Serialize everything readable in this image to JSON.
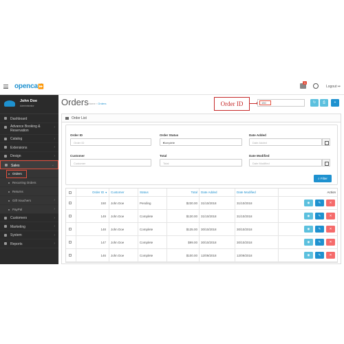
{
  "header": {
    "logo": "opencart",
    "logo_mark": "⏩",
    "alert_count": "1",
    "logout": "Logout"
  },
  "profile": {
    "name": "John Doe",
    "role": "Administrator"
  },
  "sidebar": {
    "items": [
      {
        "label": "Dashboard",
        "icon": "dashboard-icon"
      },
      {
        "label": "Advance Booking & Reservation",
        "icon": "calendar-icon"
      },
      {
        "label": "Catalog",
        "icon": "tag-icon"
      },
      {
        "label": "Extensions",
        "icon": "puzzle-icon"
      },
      {
        "label": "Design",
        "icon": "monitor-icon"
      },
      {
        "label": "Sales",
        "icon": "cart-icon"
      }
    ],
    "sales_sub": [
      "Orders",
      "Recurring Orders",
      "Returns",
      "Gift Vouchers",
      "PayPal"
    ],
    "after_items": [
      {
        "label": "Customers",
        "icon": "user-icon"
      },
      {
        "label": "Marketing",
        "icon": "share-icon"
      },
      {
        "label": "System",
        "icon": "cog-icon"
      },
      {
        "label": "Reports",
        "icon": "bar-chart-icon"
      }
    ]
  },
  "page": {
    "title": "Orders",
    "breadcrumb_home": "Home",
    "breadcrumb_sep": "›",
    "breadcrumb_current": "Orders",
    "callout": "Order ID",
    "order_id_search_value": "150"
  },
  "panel": {
    "title": "Order List",
    "filters": {
      "order_id_label": "Order ID",
      "order_id_placeholder": "Order ID",
      "status_label": "Order Status",
      "status_value": "Complete",
      "date_added_label": "Date Added",
      "date_added_placeholder": "Date Added",
      "customer_label": "Customer",
      "customer_placeholder": "Customer",
      "total_label": "Total",
      "total_placeholder": "Total",
      "date_modified_label": "Date Modified",
      "date_modified_placeholder": "Date Modified",
      "filter_button": "Filter"
    }
  },
  "table": {
    "columns": [
      "Order ID",
      "Customer",
      "Status",
      "Total",
      "Date Added",
      "Date Modified",
      "Action"
    ],
    "sort_indicator": "▼",
    "rows": [
      {
        "id": "150",
        "customer": "John Doe",
        "status": "Pending",
        "total": "$230.00",
        "added": "31/10/2018",
        "modified": "31/10/2018"
      },
      {
        "id": "149",
        "customer": "John Doe",
        "status": "Complete",
        "total": "$130.00",
        "added": "31/10/2018",
        "modified": "31/10/2018"
      },
      {
        "id": "148",
        "customer": "John Doe",
        "status": "Complete",
        "total": "$135.00",
        "added": "30/10/2018",
        "modified": "30/10/2018"
      },
      {
        "id": "147",
        "customer": "John Doe",
        "status": "Complete",
        "total": "$99.00",
        "added": "30/10/2018",
        "modified": "30/10/2018"
      },
      {
        "id": "146",
        "customer": "John Doe",
        "status": "Complete",
        "total": "$100.00",
        "added": "12/09/2018",
        "modified": "12/09/2018"
      }
    ]
  },
  "colors": {
    "accent": "#1e91cf",
    "info": "#5bc0de",
    "danger": "#f56b6b",
    "sidebar": "#2b2b2b",
    "highlight": "#e3503e"
  }
}
